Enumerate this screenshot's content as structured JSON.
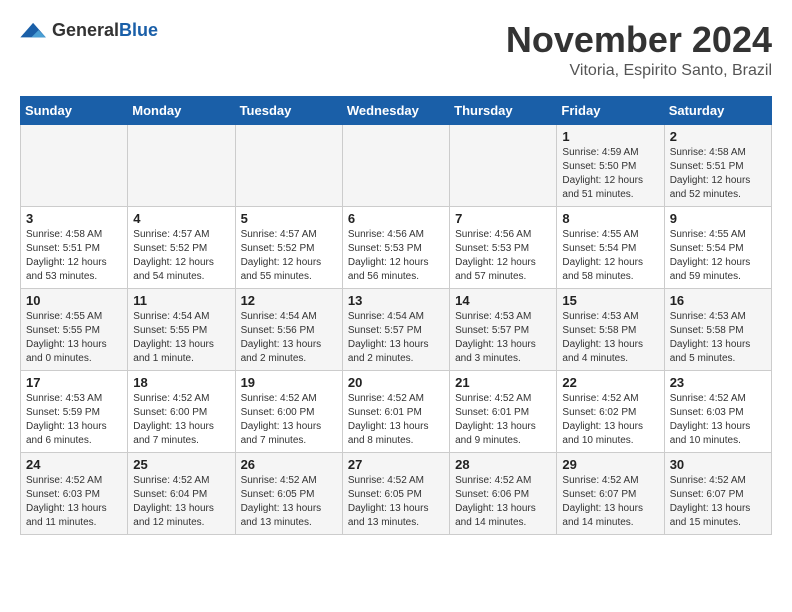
{
  "header": {
    "logo_general": "General",
    "logo_blue": "Blue",
    "month": "November 2024",
    "location": "Vitoria, Espirito Santo, Brazil"
  },
  "days_of_week": [
    "Sunday",
    "Monday",
    "Tuesday",
    "Wednesday",
    "Thursday",
    "Friday",
    "Saturday"
  ],
  "weeks": [
    [
      {
        "day": "",
        "info": ""
      },
      {
        "day": "",
        "info": ""
      },
      {
        "day": "",
        "info": ""
      },
      {
        "day": "",
        "info": ""
      },
      {
        "day": "",
        "info": ""
      },
      {
        "day": "1",
        "info": "Sunrise: 4:59 AM\nSunset: 5:50 PM\nDaylight: 12 hours\nand 51 minutes."
      },
      {
        "day": "2",
        "info": "Sunrise: 4:58 AM\nSunset: 5:51 PM\nDaylight: 12 hours\nand 52 minutes."
      }
    ],
    [
      {
        "day": "3",
        "info": "Sunrise: 4:58 AM\nSunset: 5:51 PM\nDaylight: 12 hours\nand 53 minutes."
      },
      {
        "day": "4",
        "info": "Sunrise: 4:57 AM\nSunset: 5:52 PM\nDaylight: 12 hours\nand 54 minutes."
      },
      {
        "day": "5",
        "info": "Sunrise: 4:57 AM\nSunset: 5:52 PM\nDaylight: 12 hours\nand 55 minutes."
      },
      {
        "day": "6",
        "info": "Sunrise: 4:56 AM\nSunset: 5:53 PM\nDaylight: 12 hours\nand 56 minutes."
      },
      {
        "day": "7",
        "info": "Sunrise: 4:56 AM\nSunset: 5:53 PM\nDaylight: 12 hours\nand 57 minutes."
      },
      {
        "day": "8",
        "info": "Sunrise: 4:55 AM\nSunset: 5:54 PM\nDaylight: 12 hours\nand 58 minutes."
      },
      {
        "day": "9",
        "info": "Sunrise: 4:55 AM\nSunset: 5:54 PM\nDaylight: 12 hours\nand 59 minutes."
      }
    ],
    [
      {
        "day": "10",
        "info": "Sunrise: 4:55 AM\nSunset: 5:55 PM\nDaylight: 13 hours\nand 0 minutes."
      },
      {
        "day": "11",
        "info": "Sunrise: 4:54 AM\nSunset: 5:55 PM\nDaylight: 13 hours\nand 1 minute."
      },
      {
        "day": "12",
        "info": "Sunrise: 4:54 AM\nSunset: 5:56 PM\nDaylight: 13 hours\nand 2 minutes."
      },
      {
        "day": "13",
        "info": "Sunrise: 4:54 AM\nSunset: 5:57 PM\nDaylight: 13 hours\nand 2 minutes."
      },
      {
        "day": "14",
        "info": "Sunrise: 4:53 AM\nSunset: 5:57 PM\nDaylight: 13 hours\nand 3 minutes."
      },
      {
        "day": "15",
        "info": "Sunrise: 4:53 AM\nSunset: 5:58 PM\nDaylight: 13 hours\nand 4 minutes."
      },
      {
        "day": "16",
        "info": "Sunrise: 4:53 AM\nSunset: 5:58 PM\nDaylight: 13 hours\nand 5 minutes."
      }
    ],
    [
      {
        "day": "17",
        "info": "Sunrise: 4:53 AM\nSunset: 5:59 PM\nDaylight: 13 hours\nand 6 minutes."
      },
      {
        "day": "18",
        "info": "Sunrise: 4:52 AM\nSunset: 6:00 PM\nDaylight: 13 hours\nand 7 minutes."
      },
      {
        "day": "19",
        "info": "Sunrise: 4:52 AM\nSunset: 6:00 PM\nDaylight: 13 hours\nand 7 minutes."
      },
      {
        "day": "20",
        "info": "Sunrise: 4:52 AM\nSunset: 6:01 PM\nDaylight: 13 hours\nand 8 minutes."
      },
      {
        "day": "21",
        "info": "Sunrise: 4:52 AM\nSunset: 6:01 PM\nDaylight: 13 hours\nand 9 minutes."
      },
      {
        "day": "22",
        "info": "Sunrise: 4:52 AM\nSunset: 6:02 PM\nDaylight: 13 hours\nand 10 minutes."
      },
      {
        "day": "23",
        "info": "Sunrise: 4:52 AM\nSunset: 6:03 PM\nDaylight: 13 hours\nand 10 minutes."
      }
    ],
    [
      {
        "day": "24",
        "info": "Sunrise: 4:52 AM\nSunset: 6:03 PM\nDaylight: 13 hours\nand 11 minutes."
      },
      {
        "day": "25",
        "info": "Sunrise: 4:52 AM\nSunset: 6:04 PM\nDaylight: 13 hours\nand 12 minutes."
      },
      {
        "day": "26",
        "info": "Sunrise: 4:52 AM\nSunset: 6:05 PM\nDaylight: 13 hours\nand 13 minutes."
      },
      {
        "day": "27",
        "info": "Sunrise: 4:52 AM\nSunset: 6:05 PM\nDaylight: 13 hours\nand 13 minutes."
      },
      {
        "day": "28",
        "info": "Sunrise: 4:52 AM\nSunset: 6:06 PM\nDaylight: 13 hours\nand 14 minutes."
      },
      {
        "day": "29",
        "info": "Sunrise: 4:52 AM\nSunset: 6:07 PM\nDaylight: 13 hours\nand 14 minutes."
      },
      {
        "day": "30",
        "info": "Sunrise: 4:52 AM\nSunset: 6:07 PM\nDaylight: 13 hours\nand 15 minutes."
      }
    ]
  ]
}
